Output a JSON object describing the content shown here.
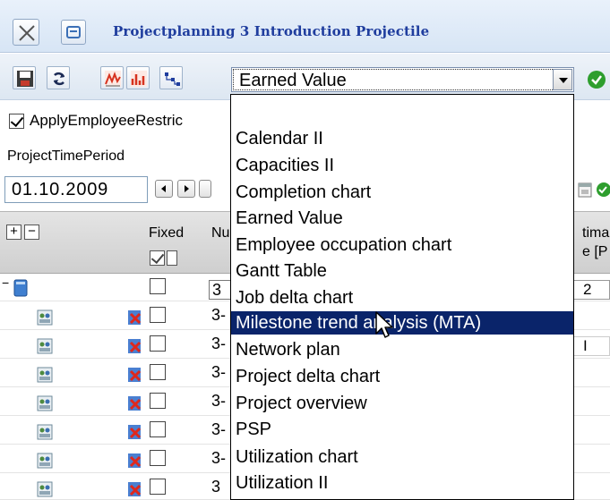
{
  "window": {
    "title": "Projectplanning 3 Introduction Projectile"
  },
  "toolbar": {
    "view_select": {
      "value": "Earned Value",
      "options": [
        "Calendar II",
        "Capacities II",
        "Completion chart",
        "Earned Value",
        "Employee occupation chart",
        "Gantt Table",
        "Job delta chart",
        "Milestone trend analysis (MTA)",
        "Network plan",
        "Project delta chart",
        "Project overview",
        "PSP",
        "Utilization chart",
        "Utilization II"
      ],
      "highlighted": "Milestone trend analysis (MTA)"
    }
  },
  "filters": {
    "apply_restriction_label": "ApplyEmployeeRestric",
    "apply_restriction_checked": true,
    "period_label": "ProjectTimePeriod",
    "period_start": "01.10.2009"
  },
  "grid": {
    "expand_label": "+",
    "collapse_label": "−",
    "headers": {
      "fixed": "Fixed",
      "number": "Nu",
      "estimate_top": "tima",
      "estimate_bottom": "e [P"
    },
    "rows": [
      {
        "number": "3",
        "estimate": "2"
      },
      {
        "number": "3-"
      },
      {
        "number": "3-",
        "estimate": "I"
      },
      {
        "number": "3-"
      },
      {
        "number": "3-"
      },
      {
        "number": "3-"
      },
      {
        "number": "3-"
      },
      {
        "number": "3"
      }
    ]
  },
  "colors": {
    "title": "#1f3d9e",
    "selection": "#0a246a",
    "ok_green": "#2e9e2e"
  }
}
